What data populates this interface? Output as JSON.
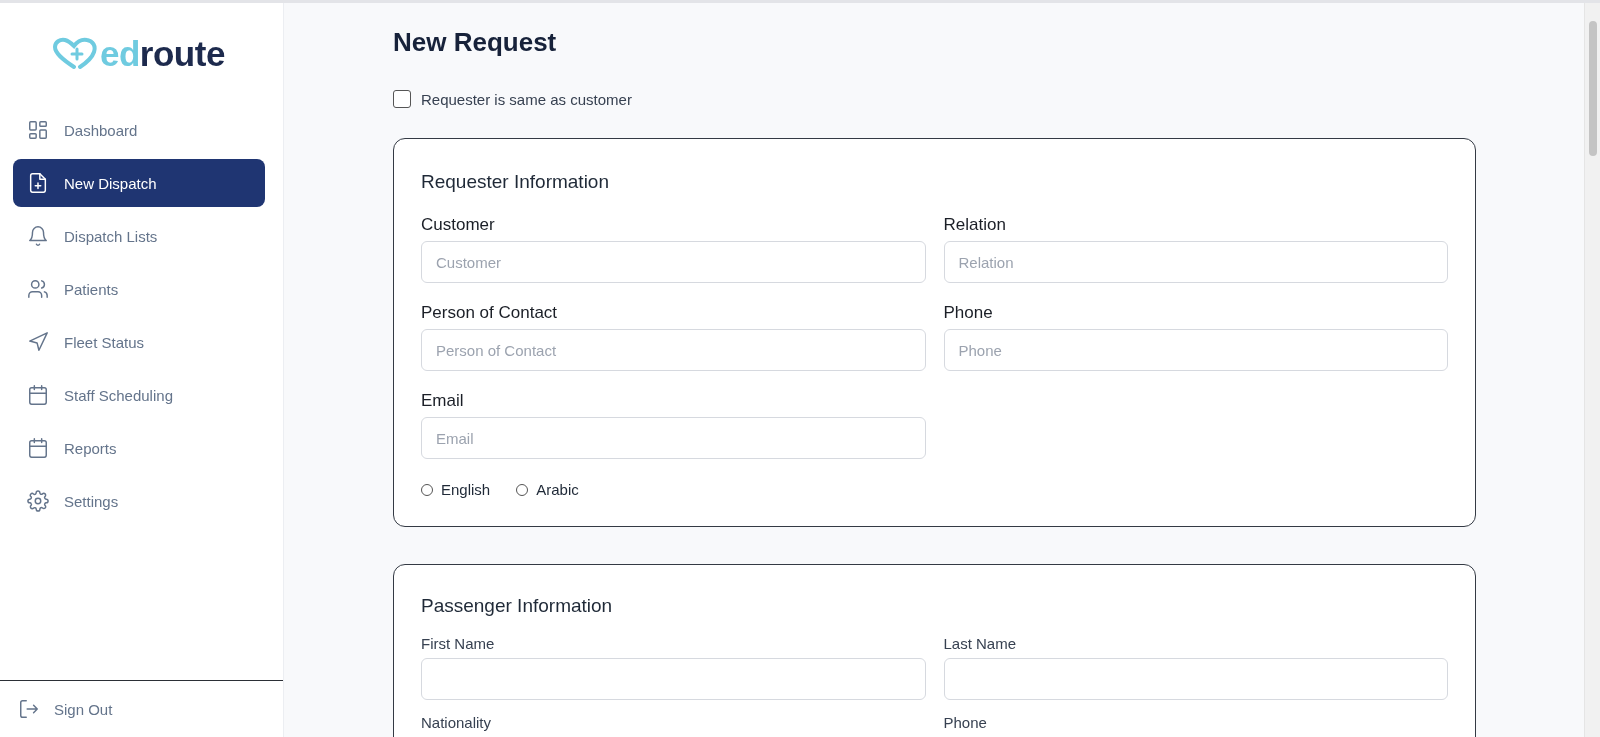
{
  "logo": {
    "accent": "ed",
    "text": "route"
  },
  "sidebar": {
    "items": [
      {
        "label": "Dashboard",
        "kind": "grid",
        "selected": false
      },
      {
        "label": "New Dispatch",
        "kind": "file",
        "selected": true
      },
      {
        "label": "Dispatch Lists",
        "kind": "bell",
        "selected": false
      },
      {
        "label": "Patients",
        "kind": "users",
        "selected": false
      },
      {
        "label": "Fleet Status",
        "kind": "navigation",
        "selected": false
      },
      {
        "label": "Staff Scheduling",
        "kind": "calendar",
        "selected": false
      },
      {
        "label": "Reports",
        "kind": "calendar",
        "selected": false
      },
      {
        "label": "Settings",
        "kind": "gear",
        "selected": false
      }
    ],
    "sign_out": "Sign Out"
  },
  "page_title": "New Request",
  "same_as_customer": {
    "label": "Requester is same as customer",
    "checked": false
  },
  "requester": {
    "title": "Requester Information",
    "fields": [
      {
        "kind": "input",
        "label": "Customer",
        "placeholder": "Customer"
      },
      {
        "kind": "input",
        "label": "Relation",
        "placeholder": "Relation"
      },
      {
        "kind": "input",
        "label": "Person of Contact",
        "placeholder": "Person of Contact"
      },
      {
        "kind": "input",
        "label": "Phone",
        "placeholder": "Phone"
      },
      {
        "kind": "input",
        "label": "Email",
        "placeholder": "Email"
      }
    ],
    "languages": [
      {
        "label": "English",
        "selected": false
      },
      {
        "label": "Arabic",
        "selected": false
      }
    ]
  },
  "passenger": {
    "title": "Passenger Information",
    "fields": [
      {
        "kind": "input",
        "label": "First Name"
      },
      {
        "kind": "input",
        "label": "Last Name"
      },
      {
        "kind": "label",
        "label": "Nationality"
      },
      {
        "kind": "label",
        "label": "Phone"
      }
    ]
  }
}
